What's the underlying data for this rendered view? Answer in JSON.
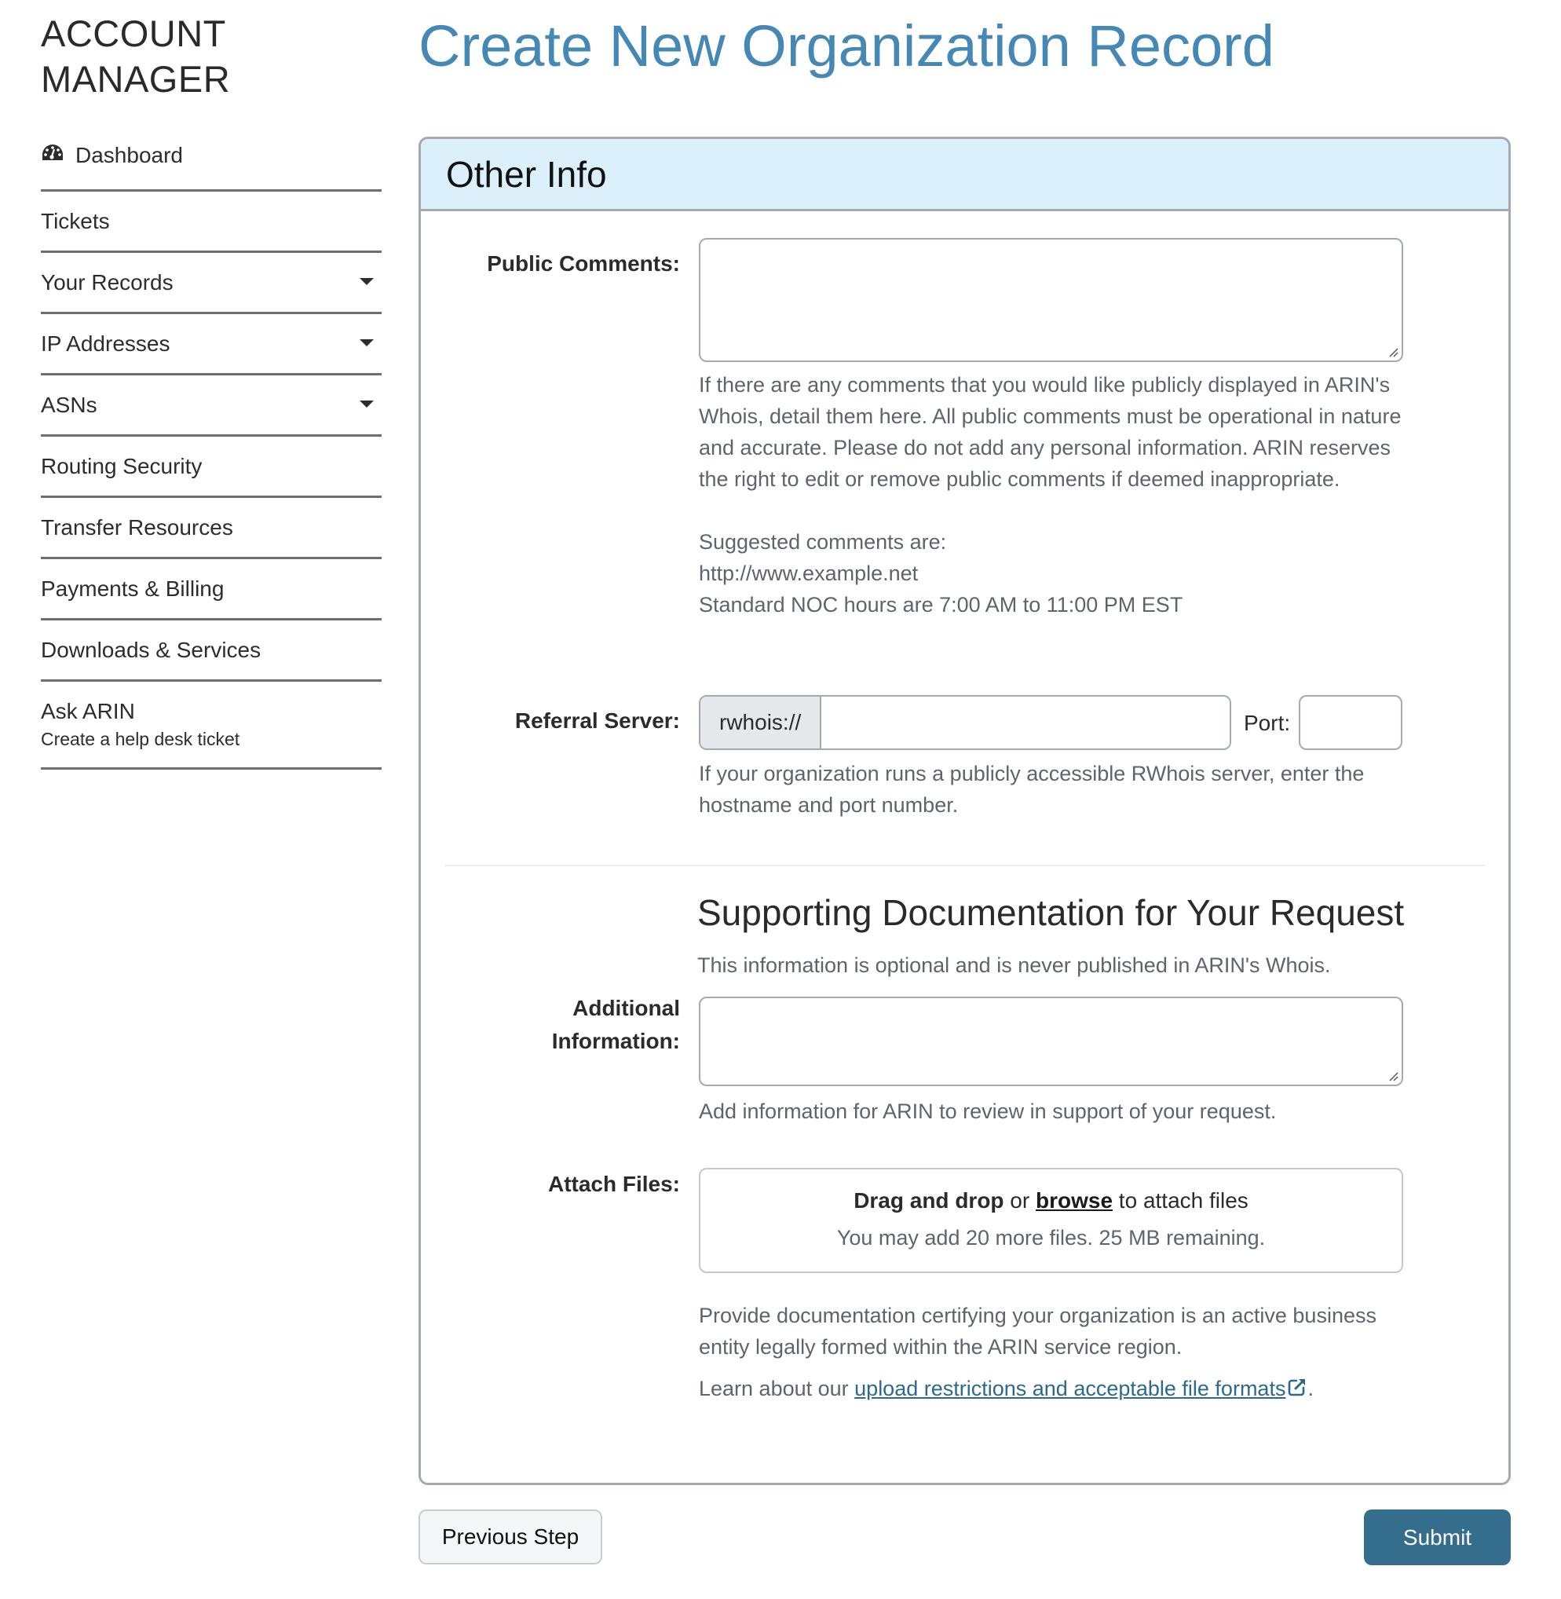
{
  "sidebar": {
    "brand_line1": "ACCOUNT",
    "brand_line2": "MANAGER",
    "items": [
      {
        "label": "Dashboard",
        "icon": "dashboard-gauge-icon"
      },
      {
        "label": "Tickets"
      },
      {
        "label": "Your Records",
        "has_dropdown": true
      },
      {
        "label": "IP Addresses",
        "has_dropdown": true
      },
      {
        "label": "ASNs",
        "has_dropdown": true
      },
      {
        "label": "Routing Security"
      },
      {
        "label": "Transfer Resources"
      },
      {
        "label": "Payments & Billing"
      },
      {
        "label": "Downloads & Services"
      },
      {
        "label": "Ask ARIN",
        "sublabel": "Create a help desk ticket"
      }
    ]
  },
  "page": {
    "title": "Create New Organization Record"
  },
  "panel": {
    "title": "Other Info",
    "public_comments": {
      "label": "Public Comments:",
      "value": "",
      "help_paragraph": "If there are any comments that you would like publicly displayed in ARIN's Whois, detail them here. All public comments must be operational in nature and accurate. Please do not add any personal information. ARIN reserves the right to edit or remove public comments if deemed inappropriate.",
      "suggested_heading": "Suggested comments are:",
      "suggested_1": "http://www.example.net",
      "suggested_2": "Standard NOC hours are 7:00 AM to 11:00 PM EST"
    },
    "referral_server": {
      "label": "Referral Server:",
      "prefix": "rwhois://",
      "value": "",
      "port_label": "Port:",
      "port_value": "",
      "help": "If your organization runs a publicly accessible RWhois server, enter the hostname and port number."
    },
    "supporting_docs": {
      "title": "Supporting Documentation for Your Request",
      "subtitle": "This information is optional and is never published in ARIN's Whois.",
      "additional_label_1": "Additional",
      "additional_label_2": "Information:",
      "additional_value": "",
      "additional_help": "Add information for ARIN to review in support of your request.",
      "attach_label": "Attach Files:",
      "drop_bold": "Drag and drop",
      "drop_or": " or ",
      "drop_browse": "browse",
      "drop_rest": " to attach files",
      "drop_limits": "You may add 20 more files. 25 MB remaining.",
      "certify_help": "Provide documentation certifying your organization is an active business entity legally formed within the ARIN service region.",
      "learn_prefix": "Learn about our ",
      "learn_link": "upload restrictions and acceptable file formats",
      "learn_suffix": "."
    }
  },
  "buttons": {
    "previous": "Previous Step",
    "submit": "Submit"
  },
  "colors": {
    "title_blue": "#4588b5",
    "header_bg": "#dcf0fb",
    "submit_bg": "#356d8d",
    "link": "#2c6a8c"
  }
}
